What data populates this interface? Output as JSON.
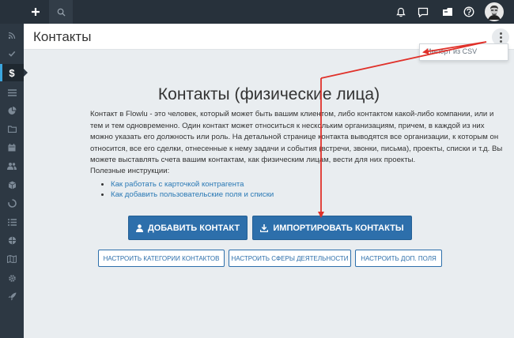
{
  "topbar": {
    "add_icon": "plus-icon",
    "search_icon": "search-icon",
    "notifications_icon": "bell-icon",
    "messages_icon": "chat-icon",
    "inbox_icon": "inbox-icon",
    "help_icon": "help-icon"
  },
  "sidebar": {
    "items": [
      {
        "icon": "rss-icon"
      },
      {
        "icon": "check-icon"
      },
      {
        "icon": "dollar-icon",
        "label": "$"
      },
      {
        "icon": "list-icon"
      },
      {
        "icon": "pie-chart-icon"
      },
      {
        "icon": "folder-icon"
      },
      {
        "icon": "calendar-icon"
      },
      {
        "icon": "users-icon"
      },
      {
        "icon": "box-icon"
      },
      {
        "icon": "spinner-icon"
      },
      {
        "icon": "tasks-icon"
      },
      {
        "icon": "globe-icon"
      },
      {
        "icon": "map-icon"
      },
      {
        "icon": "gear-icon"
      },
      {
        "icon": "rocket-icon"
      }
    ]
  },
  "header": {
    "title": "Контакты",
    "menu_icon": "more-vertical-icon"
  },
  "dropdown": {
    "item": "Импорт из CSV"
  },
  "main": {
    "title": "Контакты (физические лица)",
    "description": "Контакт в Flowlu - это человек, который может быть вашим клиентом, либо контактом какой-либо компании, или и тем и тем одновременно. Один контакт может относиться к нескольким организациям, причем, в каждой из них можно указать его должность или роль. На детальной странице контакта выводятся все организации, к которым он относится, все его сделки, отнесенные к нему задачи и события (встречи, звонки, письма), проекты, списки и т.д. Вы можете выставлять счета вашим контактам, как физическим лицам, вести для них проекты.",
    "help_title": "Полезные инструкции:",
    "links": [
      "Как работать с карточкой контрагента",
      "Как добавить пользовательские поля и списки"
    ],
    "add_contact": "ДОБАВИТЬ КОНТАКТ",
    "import_contacts": "ИМПОРТИРОВАТЬ КОНТАКТЫ",
    "config_buttons": [
      "НАСТРОИТЬ КАТЕГОРИИ КОНТАКТОВ",
      "НАСТРОИТЬ СФЕРЫ ДЕЯТЕЛЬНОСТИ",
      "НАСТРОИТЬ ДОП. ПОЛЯ"
    ]
  },
  "colors": {
    "topbar": "#27313b",
    "sidebar": "#2d3843",
    "primary": "#2d6fab",
    "link": "#2a79b5",
    "annotation": "#e0312a"
  }
}
